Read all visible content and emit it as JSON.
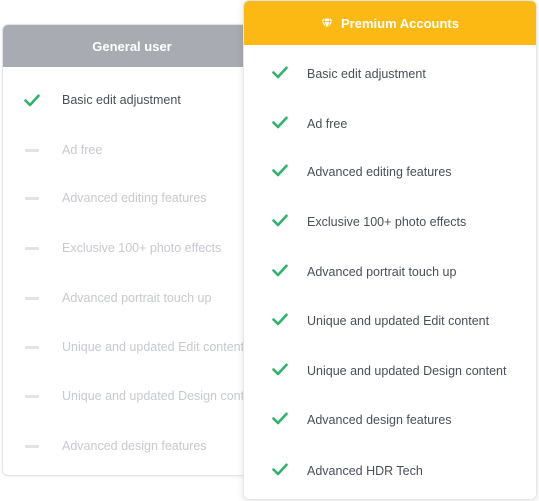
{
  "general": {
    "title": "General user",
    "features": [
      {
        "label": "Basic edit adjustment",
        "included": true
      },
      {
        "label": "Ad free",
        "included": false
      },
      {
        "label": "Advanced editing features",
        "included": false
      },
      {
        "label": "Exclusive 100+ photo effects",
        "included": false
      },
      {
        "label": "Advanced portrait touch up",
        "included": false
      },
      {
        "label": "Unique and updated Edit content",
        "included": false
      },
      {
        "label": "Unique and updated Design content",
        "included": false
      },
      {
        "label": "Advanced design features",
        "included": false
      }
    ]
  },
  "premium": {
    "title": "Premium Accounts",
    "icon": "diamond-icon",
    "features": [
      {
        "label": "Basic edit adjustment",
        "included": true
      },
      {
        "label": "Ad free",
        "included": true
      },
      {
        "label": "Advanced editing features",
        "included": true
      },
      {
        "label": "Exclusive 100+ photo effects",
        "included": true
      },
      {
        "label": "Advanced portrait touch up",
        "included": true
      },
      {
        "label": "Unique and updated Edit content",
        "included": true
      },
      {
        "label": "Unique and updated Design content",
        "included": true
      },
      {
        "label": "Advanced design features",
        "included": true
      },
      {
        "label": "Advanced HDR Tech",
        "included": true
      }
    ]
  },
  "colors": {
    "check": "#2fb36b",
    "premium_header": "#fdb913",
    "general_header": "#a9abb3"
  }
}
